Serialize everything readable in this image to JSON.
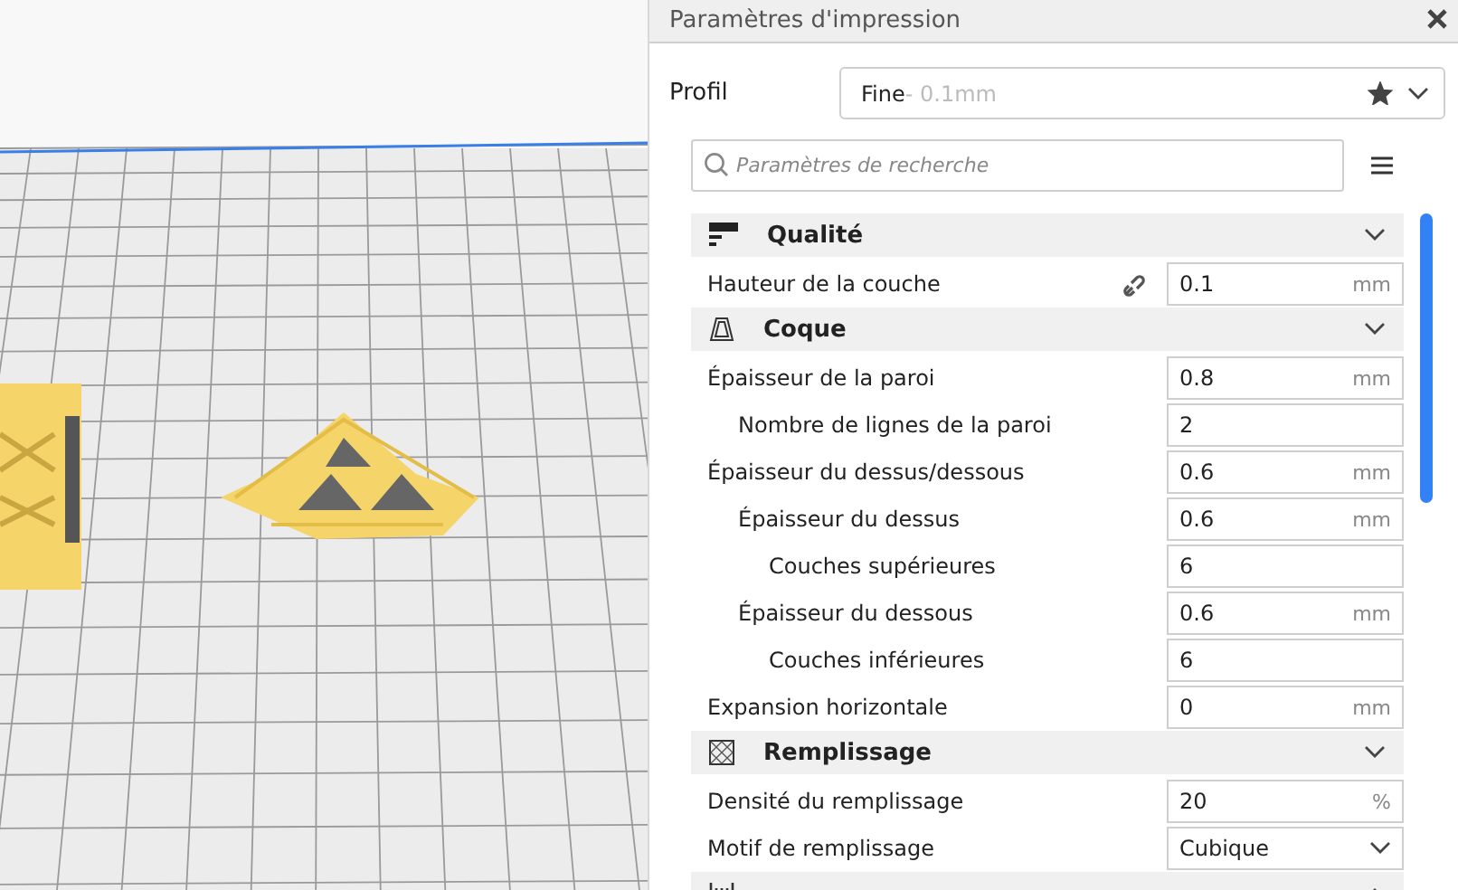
{
  "panel": {
    "title": "Paramètres d'impression"
  },
  "profile": {
    "label": "Profil",
    "name": "Fine",
    "detail": " - 0.1mm",
    "favorite": true
  },
  "search": {
    "placeholder": "Paramètres de recherche"
  },
  "sections": [
    {
      "title": "Qualité",
      "kind": "quality",
      "expanded": true,
      "settings": [
        {
          "label": "Hauteur de la couche",
          "kind": "number",
          "value": "0.1",
          "unit": "mm",
          "linked": true
        }
      ]
    },
    {
      "title": "Coque",
      "kind": "shell",
      "expanded": true,
      "settings": [
        {
          "label": "Épaisseur de la paroi",
          "kind": "number",
          "value": "0.8",
          "unit": "mm",
          "children": [
            {
              "label": "Nombre de lignes de la paroi",
              "kind": "number",
              "value": "2"
            }
          ]
        },
        {
          "label": "Épaisseur du dessus/dessous",
          "kind": "number",
          "value": "0.6",
          "unit": "mm",
          "children": [
            {
              "label": "Épaisseur du dessus",
              "kind": "number",
              "value": "0.6",
              "unit": "mm",
              "children": [
                {
                  "label": "Couches supérieures",
                  "kind": "number",
                  "value": "6"
                }
              ]
            },
            {
              "label": "Épaisseur du dessous",
              "kind": "number",
              "value": "0.6",
              "unit": "mm",
              "children": [
                {
                  "label": "Couches inférieures",
                  "kind": "number",
                  "value": "6"
                }
              ]
            }
          ]
        },
        {
          "label": "Expansion horizontale",
          "kind": "number",
          "value": "0",
          "unit": "mm"
        }
      ]
    },
    {
      "title": "Remplissage",
      "kind": "infill",
      "expanded": true,
      "settings": [
        {
          "label": "Densité du remplissage",
          "kind": "number",
          "value": "20",
          "unit": "%"
        },
        {
          "label": "Motif de remplissage",
          "kind": "select",
          "value": "Cubique"
        }
      ]
    },
    {
      "kind": "material",
      "expanded": false
    }
  ]
}
